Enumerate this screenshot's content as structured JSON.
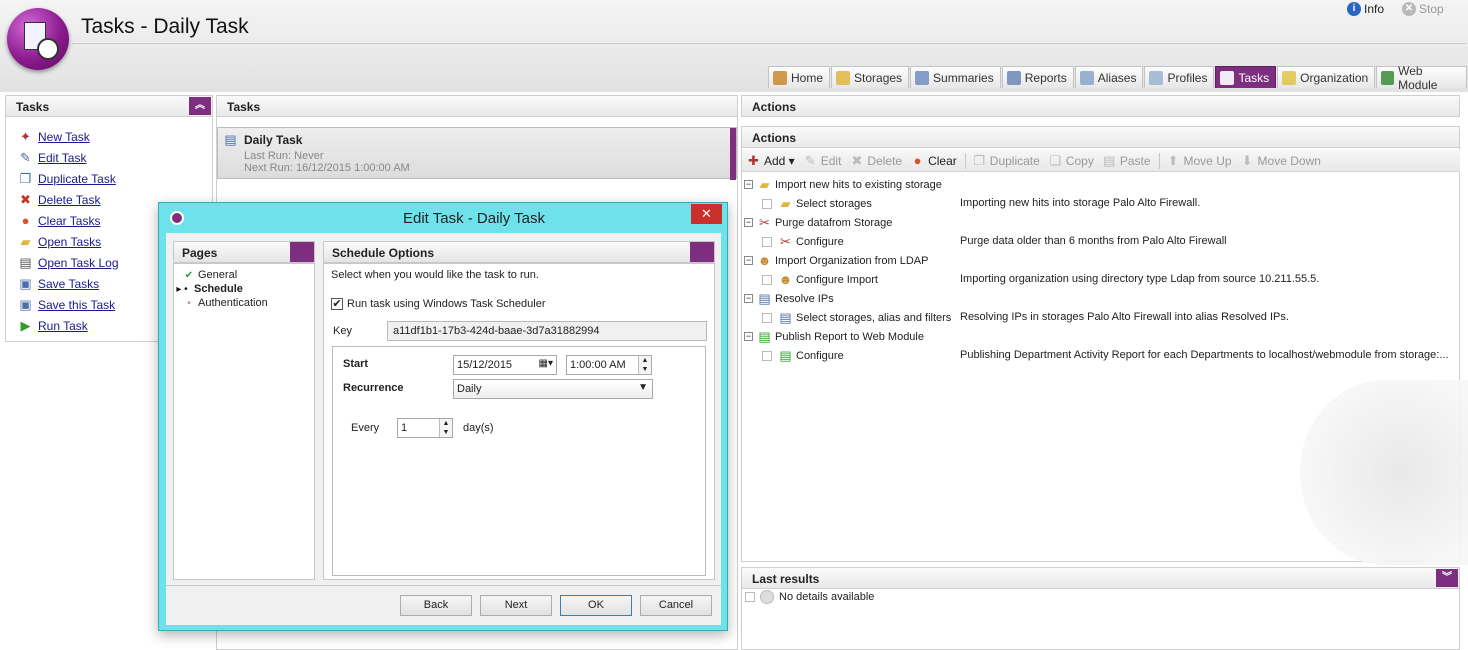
{
  "app": {
    "title": "Tasks - Daily Task",
    "info_label": "Info",
    "stop_label": "Stop"
  },
  "nav_tabs": [
    {
      "label": "Home",
      "icon": "home-icon",
      "color": "#c9892f"
    },
    {
      "label": "Storages",
      "icon": "storages-icon",
      "color": "#e0b640"
    },
    {
      "label": "Summaries",
      "icon": "summaries-icon",
      "color": "#6e8ec0"
    },
    {
      "label": "Reports",
      "icon": "reports-icon",
      "color": "#6a88b8"
    },
    {
      "label": "Aliases",
      "icon": "aliases-icon",
      "color": "#8aa6c8"
    },
    {
      "label": "Profiles",
      "icon": "profiles-icon",
      "color": "#9bb4d0"
    },
    {
      "label": "Tasks",
      "icon": "tasks-icon",
      "color": "#ffffff",
      "active": true
    },
    {
      "label": "Organization",
      "icon": "organization-icon",
      "color": "#e2c34a"
    },
    {
      "label": "Web Module",
      "icon": "web-module-icon",
      "color": "#3a8c3a"
    }
  ],
  "left_panel": {
    "title": "Tasks",
    "items": [
      {
        "label": "New Task",
        "icon": "new-task-icon",
        "glyph": "✦",
        "color": "#b03535"
      },
      {
        "label": "Edit Task",
        "icon": "edit-task-icon",
        "glyph": "✎",
        "color": "#4a6ea9"
      },
      {
        "label": "Duplicate Task",
        "icon": "duplicate-task-icon",
        "glyph": "❐",
        "color": "#4a6ea9"
      },
      {
        "label": "Delete Task",
        "icon": "delete-task-icon",
        "glyph": "✖",
        "color": "#c0392b"
      },
      {
        "label": "Clear Tasks",
        "icon": "clear-tasks-icon",
        "glyph": "●",
        "color": "#d9532e"
      },
      {
        "label": "Open Tasks",
        "icon": "open-tasks-icon",
        "glyph": "▰",
        "color": "#e2b53c"
      },
      {
        "label": "Open Task Log",
        "icon": "open-task-log-icon",
        "glyph": "▤",
        "color": "#555555"
      },
      {
        "label": "Save Tasks",
        "icon": "save-tasks-icon",
        "glyph": "▣",
        "color": "#4a6ea9"
      },
      {
        "label": "Save this Task",
        "icon": "save-this-task-icon",
        "glyph": "▣",
        "color": "#4a6ea9"
      },
      {
        "label": "Run Task",
        "icon": "run-task-icon",
        "glyph": "▶",
        "color": "#2e9e2e"
      }
    ]
  },
  "middle_panel": {
    "title": "Tasks",
    "task": {
      "name": "Daily Task",
      "last_run": "Last Run: Never",
      "next_run": "Next Run: 16/12/2015 1:00:00 AM"
    }
  },
  "actions_panel": {
    "title": "Actions",
    "sub_title": "Actions",
    "toolbar": [
      {
        "label": "Add ▾",
        "icon": "add-icon",
        "enabled": true
      },
      {
        "label": "Edit",
        "icon": "edit-icon",
        "enabled": false
      },
      {
        "label": "Delete",
        "icon": "delete-icon",
        "enabled": false
      },
      {
        "label": "Clear",
        "icon": "clear-icon",
        "enabled": true
      },
      {
        "label": "Duplicate",
        "icon": "duplicate-icon",
        "enabled": false
      },
      {
        "label": "Copy",
        "icon": "copy-icon",
        "enabled": false
      },
      {
        "label": "Paste",
        "icon": "paste-icon",
        "enabled": false
      },
      {
        "label": "Move Up",
        "icon": "move-up-icon",
        "enabled": false
      },
      {
        "label": "Move Down",
        "icon": "move-down-icon",
        "enabled": false
      }
    ],
    "groups": [
      {
        "label": "Import new hits to existing storage",
        "icon": "import-icon",
        "child": {
          "label": "Select storages",
          "desc": "Importing new hits into storage Palo Alto Firewall."
        }
      },
      {
        "label": "Purge datafrom Storage",
        "icon": "purge-icon",
        "child": {
          "label": "Configure",
          "desc": "Purge data older than 6 months from Palo Alto Firewall"
        }
      },
      {
        "label": "Import Organization from LDAP",
        "icon": "ldap-icon",
        "child": {
          "label": "Configure Import",
          "desc": "Importing organization using directory type Ldap from source 10.211.55.5."
        }
      },
      {
        "label": "Resolve IPs",
        "icon": "resolve-ips-icon",
        "child": {
          "label": "Select storages, alias and filters",
          "desc": "Resolving IPs in storages Palo Alto Firewall into alias Resolved IPs."
        }
      },
      {
        "label": "Publish Report to Web Module",
        "icon": "publish-icon",
        "child": {
          "label": "Configure",
          "desc": "Publishing Department Activity Report for each Departments to localhost/webmodule from storage:..."
        }
      }
    ]
  },
  "results_panel": {
    "title": "Last results",
    "empty_text": "No details available"
  },
  "dialog": {
    "title": "Edit Task - Daily Task",
    "close_glyph": "✕",
    "pages_title": "Pages",
    "pages": [
      {
        "label": "General",
        "state": "done"
      },
      {
        "label": "Schedule",
        "state": "current"
      },
      {
        "label": "Authentication",
        "state": "pending"
      }
    ],
    "options_title": "Schedule Options",
    "description": "Select when you would like the task to run.",
    "use_scheduler_label": "Run task using Windows Task Scheduler",
    "use_scheduler_checked": true,
    "key_label": "Key",
    "key_value": "a11df1b1-17b3-424d-baae-3d7a31882994",
    "start_label": "Start",
    "start_date": "15/12/2015",
    "start_time": "1:00:00 AM",
    "recurrence_label": "Recurrence",
    "recurrence_value": "Daily",
    "every_label": "Every",
    "every_value": "1",
    "every_unit": "day(s)",
    "buttons": {
      "back": "Back",
      "next": "Next",
      "ok": "OK",
      "cancel": "Cancel"
    }
  }
}
